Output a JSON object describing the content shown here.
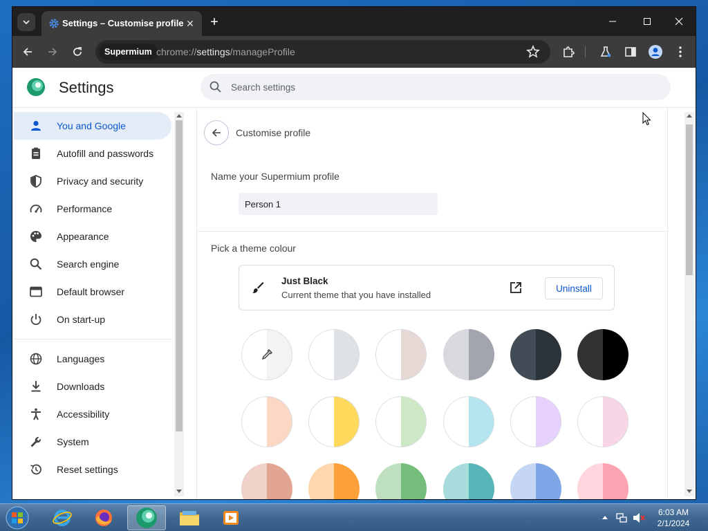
{
  "window": {
    "tab_title": "Settings – Customise profile",
    "address": {
      "chip": "Supermium",
      "scheme": "chrome://",
      "host": "settings",
      "path": "/manageProfile"
    }
  },
  "header": {
    "title": "Settings",
    "search_placeholder": "Search settings"
  },
  "sidebar": {
    "items": [
      {
        "label": "You and Google",
        "icon": "person-icon",
        "active": true
      },
      {
        "label": "Autofill and passwords",
        "icon": "clipboard-icon"
      },
      {
        "label": "Privacy and security",
        "icon": "shield-icon"
      },
      {
        "label": "Performance",
        "icon": "speedometer-icon"
      },
      {
        "label": "Appearance",
        "icon": "palette-icon"
      },
      {
        "label": "Search engine",
        "icon": "search-icon"
      },
      {
        "label": "Default browser",
        "icon": "browser-window-icon"
      },
      {
        "label": "On start-up",
        "icon": "power-icon"
      },
      {
        "label": "Languages",
        "icon": "globe-icon"
      },
      {
        "label": "Downloads",
        "icon": "download-icon"
      },
      {
        "label": "Accessibility",
        "icon": "accessibility-icon"
      },
      {
        "label": "System",
        "icon": "wrench-icon"
      },
      {
        "label": "Reset settings",
        "icon": "history-icon"
      }
    ]
  },
  "main": {
    "subpage_title": "Customise profile",
    "name_section_label": "Name your Supermium profile",
    "profile_name": "Person 1",
    "theme_section_label": "Pick a theme colour",
    "current_theme": {
      "name": "Just Black",
      "description": "Current theme that you have installed",
      "uninstall_label": "Uninstall"
    },
    "swatches": [
      {
        "left": "#ffffff",
        "right": "#f1f3f5",
        "custom": true
      },
      {
        "left": "#ffffff",
        "right": "#dee1e6"
      },
      {
        "left": "#ffffff",
        "right": "#e6d8d4"
      },
      {
        "left": "#d7d9de",
        "right": "#a2a5ad"
      },
      {
        "left": "#414c57",
        "right": "#2b3238"
      },
      {
        "left": "#323232",
        "right": "#000000"
      },
      {
        "left": "#ffffff",
        "right": "#fcd8c4"
      },
      {
        "left": "#ffffff",
        "right": "#fed95c"
      },
      {
        "left": "#ffffff",
        "right": "#cde8c5"
      },
      {
        "left": "#ffffff",
        "right": "#b3e5ef"
      },
      {
        "left": "#ffffff",
        "right": "#e6d0fc"
      },
      {
        "left": "#ffffff",
        "right": "#f8d6e5"
      },
      {
        "left": "#f0d1c9",
        "right": "#e3a593"
      },
      {
        "left": "#fed7ad",
        "right": "#fca13a"
      },
      {
        "left": "#bfe0c0",
        "right": "#75bd7a"
      },
      {
        "left": "#a8dcdc",
        "right": "#57b5b7"
      },
      {
        "left": "#c5d6f5",
        "right": "#7fa6e6"
      },
      {
        "left": "#ffd6dd",
        "right": "#fca3b2"
      }
    ]
  },
  "taskbar": {
    "time": "6:03 AM",
    "date": "2/1/2024"
  },
  "colors": {
    "accent": "#0b57d0",
    "active_nav_bg": "#e4ecf8",
    "titlebar": "#1f1f1f",
    "toolbar": "#3c3c3c"
  }
}
